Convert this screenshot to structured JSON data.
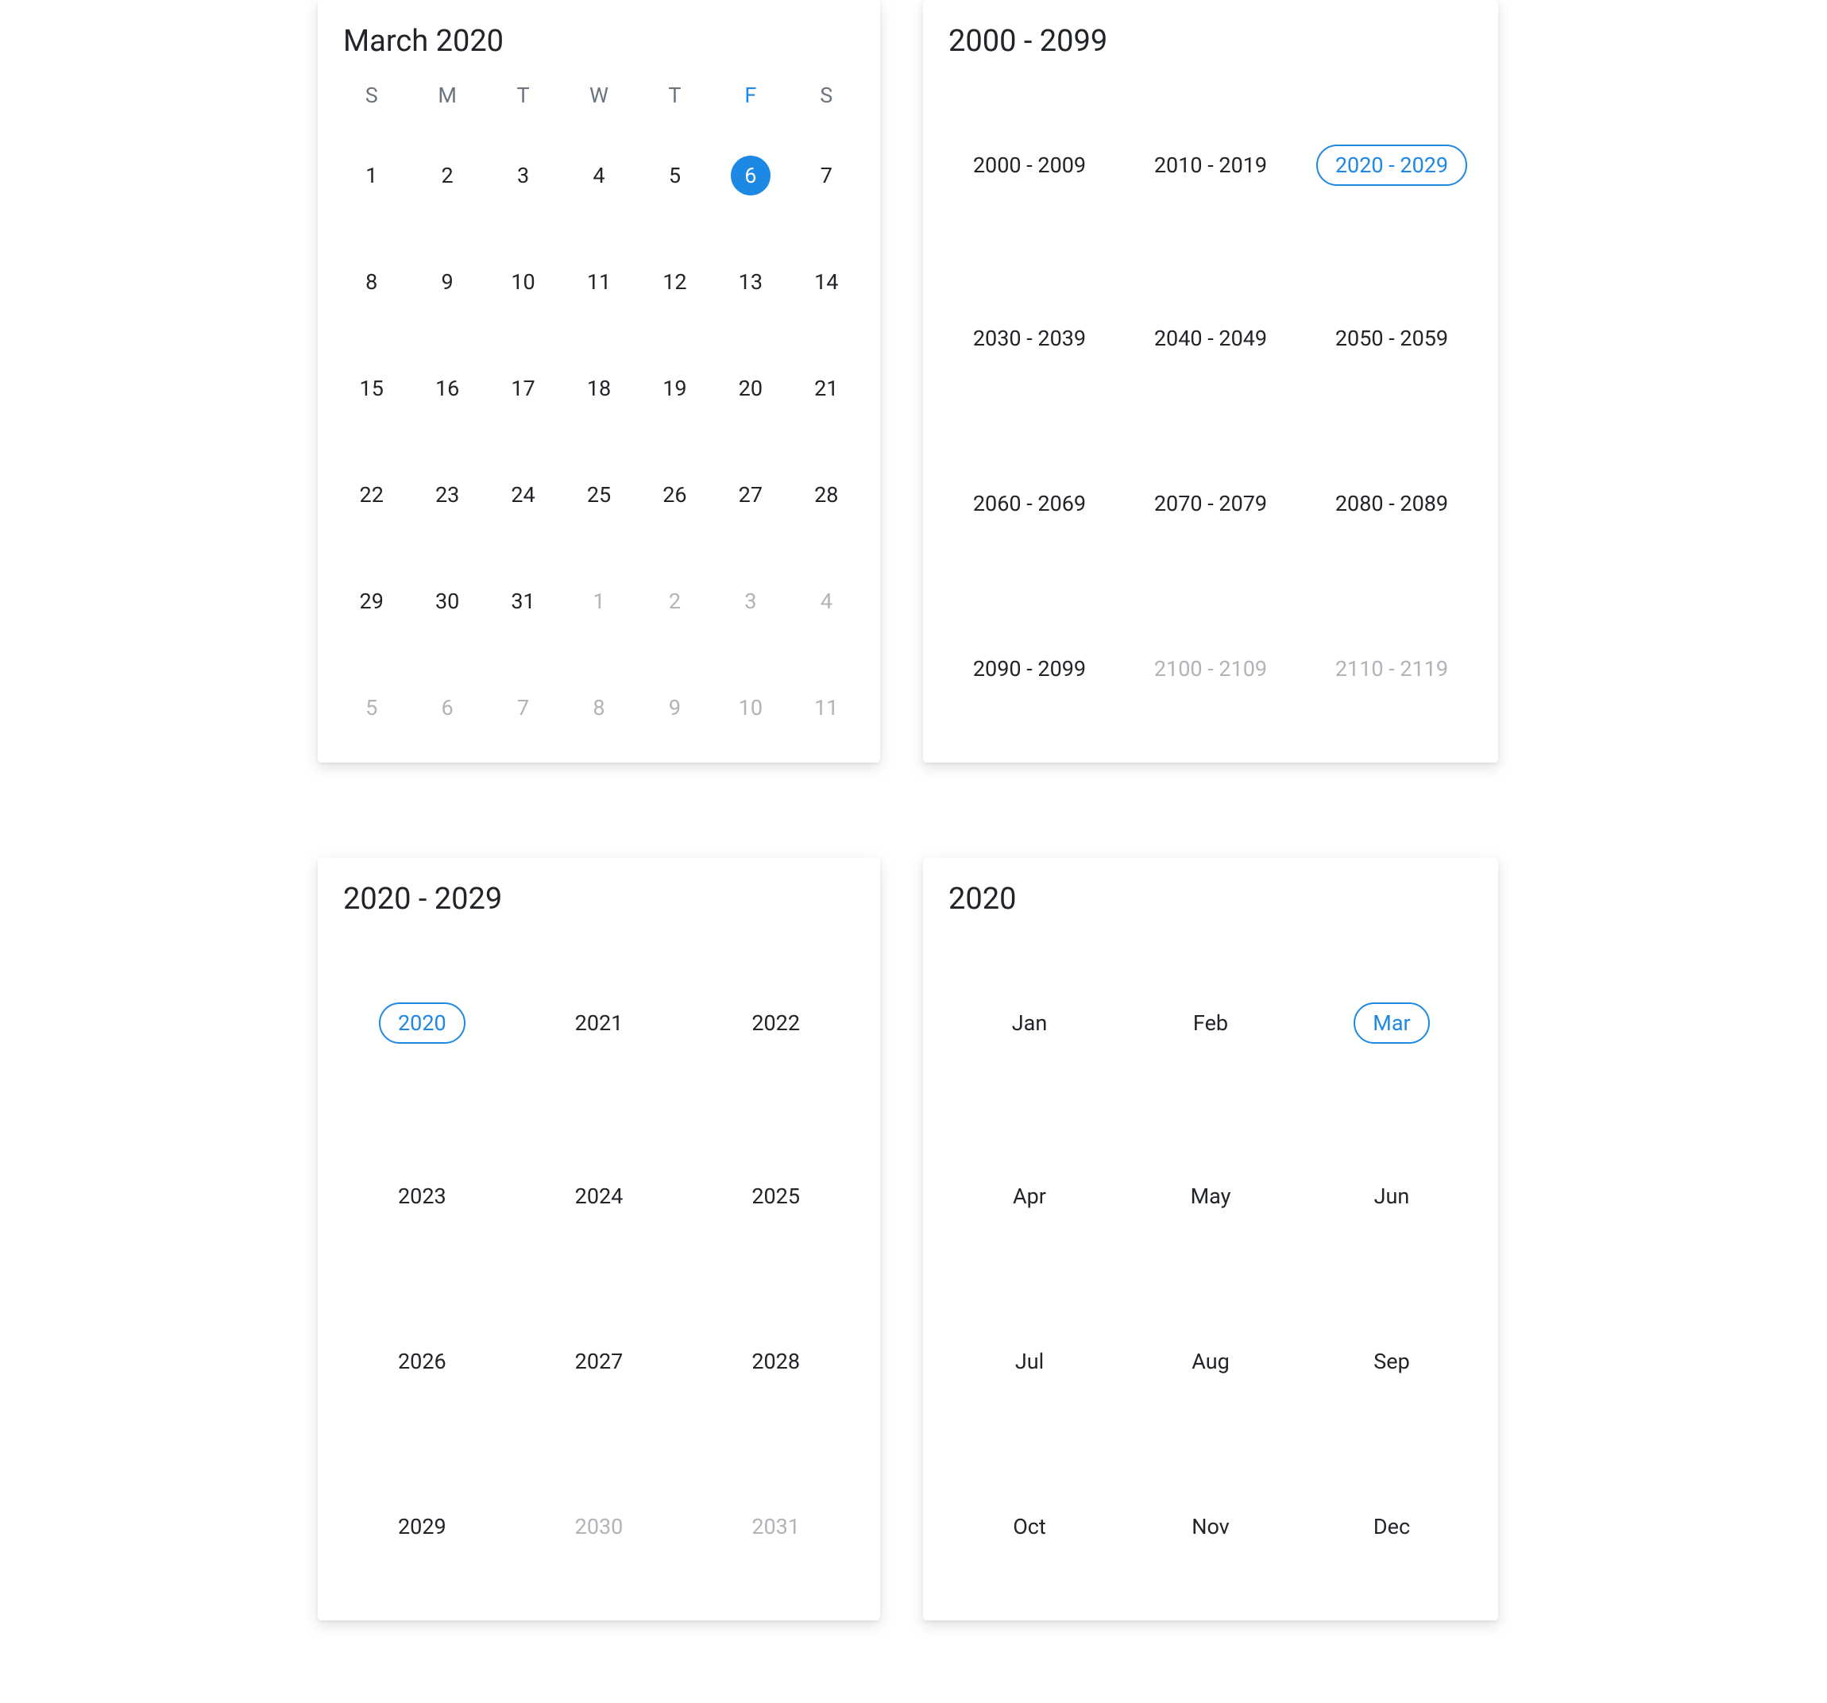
{
  "colors": {
    "accent": "#1e88e5",
    "muted": "#b0b3b8",
    "text": "#212529"
  },
  "month_view": {
    "title": "March 2020",
    "weekdays": [
      "S",
      "M",
      "T",
      "W",
      "T",
      "F",
      "S"
    ],
    "highlight_weekday_index": 5,
    "days": [
      {
        "n": "1",
        "m": false
      },
      {
        "n": "2",
        "m": false
      },
      {
        "n": "3",
        "m": false
      },
      {
        "n": "4",
        "m": false
      },
      {
        "n": "5",
        "m": false
      },
      {
        "n": "6",
        "m": false,
        "sel": true
      },
      {
        "n": "7",
        "m": false
      },
      {
        "n": "8",
        "m": false
      },
      {
        "n": "9",
        "m": false
      },
      {
        "n": "10",
        "m": false
      },
      {
        "n": "11",
        "m": false
      },
      {
        "n": "12",
        "m": false
      },
      {
        "n": "13",
        "m": false
      },
      {
        "n": "14",
        "m": false
      },
      {
        "n": "15",
        "m": false
      },
      {
        "n": "16",
        "m": false
      },
      {
        "n": "17",
        "m": false
      },
      {
        "n": "18",
        "m": false
      },
      {
        "n": "19",
        "m": false
      },
      {
        "n": "20",
        "m": false
      },
      {
        "n": "21",
        "m": false
      },
      {
        "n": "22",
        "m": false
      },
      {
        "n": "23",
        "m": false
      },
      {
        "n": "24",
        "m": false
      },
      {
        "n": "25",
        "m": false
      },
      {
        "n": "26",
        "m": false
      },
      {
        "n": "27",
        "m": false
      },
      {
        "n": "28",
        "m": false
      },
      {
        "n": "29",
        "m": false
      },
      {
        "n": "30",
        "m": false
      },
      {
        "n": "31",
        "m": false
      },
      {
        "n": "1",
        "m": true
      },
      {
        "n": "2",
        "m": true
      },
      {
        "n": "3",
        "m": true
      },
      {
        "n": "4",
        "m": true
      },
      {
        "n": "5",
        "m": true
      },
      {
        "n": "6",
        "m": true
      },
      {
        "n": "7",
        "m": true
      },
      {
        "n": "8",
        "m": true
      },
      {
        "n": "9",
        "m": true
      },
      {
        "n": "10",
        "m": true
      },
      {
        "n": "11",
        "m": true
      }
    ]
  },
  "century_view": {
    "title": "2000 - 2099",
    "items": [
      {
        "label": "2000 - 2009",
        "m": false
      },
      {
        "label": "2010 - 2019",
        "m": false
      },
      {
        "label": "2020 - 2029",
        "m": false,
        "sel": true
      },
      {
        "label": "2030 - 2039",
        "m": false
      },
      {
        "label": "2040 - 2049",
        "m": false
      },
      {
        "label": "2050 - 2059",
        "m": false
      },
      {
        "label": "2060 - 2069",
        "m": false
      },
      {
        "label": "2070 - 2079",
        "m": false
      },
      {
        "label": "2080 - 2089",
        "m": false
      },
      {
        "label": "2090 - 2099",
        "m": false
      },
      {
        "label": "2100 - 2109",
        "m": true
      },
      {
        "label": "2110 - 2119",
        "m": true
      }
    ]
  },
  "decade_view": {
    "title": "2020 - 2029",
    "items": [
      {
        "label": "2020",
        "m": false,
        "sel": true
      },
      {
        "label": "2021",
        "m": false
      },
      {
        "label": "2022",
        "m": false
      },
      {
        "label": "2023",
        "m": false
      },
      {
        "label": "2024",
        "m": false
      },
      {
        "label": "2025",
        "m": false
      },
      {
        "label": "2026",
        "m": false
      },
      {
        "label": "2027",
        "m": false
      },
      {
        "label": "2028",
        "m": false
      },
      {
        "label": "2029",
        "m": false
      },
      {
        "label": "2030",
        "m": true
      },
      {
        "label": "2031",
        "m": true
      }
    ]
  },
  "monthpick_view": {
    "title": "2020",
    "items": [
      {
        "label": "Jan",
        "m": false
      },
      {
        "label": "Feb",
        "m": false
      },
      {
        "label": "Mar",
        "m": false,
        "sel": true
      },
      {
        "label": "Apr",
        "m": false
      },
      {
        "label": "May",
        "m": false
      },
      {
        "label": "Jun",
        "m": false
      },
      {
        "label": "Jul",
        "m": false
      },
      {
        "label": "Aug",
        "m": false
      },
      {
        "label": "Sep",
        "m": false
      },
      {
        "label": "Oct",
        "m": false
      },
      {
        "label": "Nov",
        "m": false
      },
      {
        "label": "Dec",
        "m": false
      }
    ]
  }
}
